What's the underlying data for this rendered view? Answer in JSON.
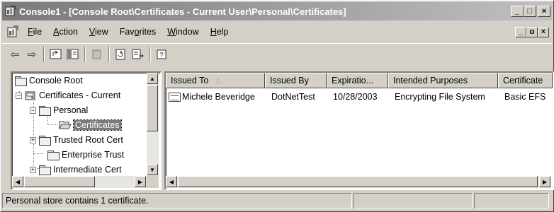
{
  "window": {
    "title": "Console1 - [Console Root\\Certificates - Current User\\Personal\\Certificates]"
  },
  "caption_buttons": {
    "minimize": "_",
    "maximize": "□",
    "close": "×"
  },
  "menu": {
    "items": [
      {
        "label": "File",
        "mnemonic": "F"
      },
      {
        "label": "Action",
        "mnemonic": "A"
      },
      {
        "label": "View",
        "mnemonic": "V"
      },
      {
        "label": "Favorites",
        "mnemonic": "o"
      },
      {
        "label": "Window",
        "mnemonic": "W"
      },
      {
        "label": "Help",
        "mnemonic": "H"
      }
    ]
  },
  "mdi_buttons": {
    "minimize": "_",
    "restore": "ɑ",
    "close": "×"
  },
  "toolbar": {
    "icons": [
      "back-arrow-icon",
      "forward-arrow-icon",
      "up-one-level-icon",
      "show-hide-tree-icon",
      "delete-icon",
      "refresh-icon",
      "export-list-icon",
      "help-icon"
    ],
    "glyphs": {
      "back": "⇦",
      "forward": "⇨",
      "up": "⮤",
      "tree": "▥",
      "delete": "▦",
      "refresh": "⟳",
      "export": "⇥",
      "help": "?"
    }
  },
  "tree": {
    "items": [
      {
        "label": "Console Root",
        "expander": ""
      },
      {
        "label": "Certificates - Current",
        "expander": "−"
      },
      {
        "label": "Personal",
        "expander": "−"
      },
      {
        "label": "Certificates",
        "expander": "",
        "selected": true
      },
      {
        "label": "Trusted Root Cert",
        "expander": "+"
      },
      {
        "label": "Enterprise Trust",
        "expander": ""
      },
      {
        "label": "Intermediate Cert",
        "expander": "+"
      }
    ]
  },
  "list": {
    "columns": [
      {
        "label": "Issued To",
        "sort_indicator": "△"
      },
      {
        "label": "Issued By"
      },
      {
        "label": "Expiratio..."
      },
      {
        "label": "Intended Purposes"
      },
      {
        "label": "Certificate"
      }
    ],
    "rows": [
      {
        "issued_to": "Michele Beveridge",
        "issued_by": "DotNetTest",
        "expiration": "10/28/2003",
        "purposes": "Encrypting File System",
        "template": "Basic EFS"
      }
    ]
  },
  "scroll_glyphs": {
    "up": "▲",
    "down": "▼",
    "left": "◀",
    "right": "▶"
  },
  "status": {
    "text": "Personal store contains 1 certificate.",
    "panels": [
      "",
      ""
    ]
  },
  "colors": {
    "face": "#d4d0c8",
    "titlebar_start": "#7a7a7a",
    "titlebar_end": "#c0c0c0",
    "selection": "#7a7a7a"
  }
}
